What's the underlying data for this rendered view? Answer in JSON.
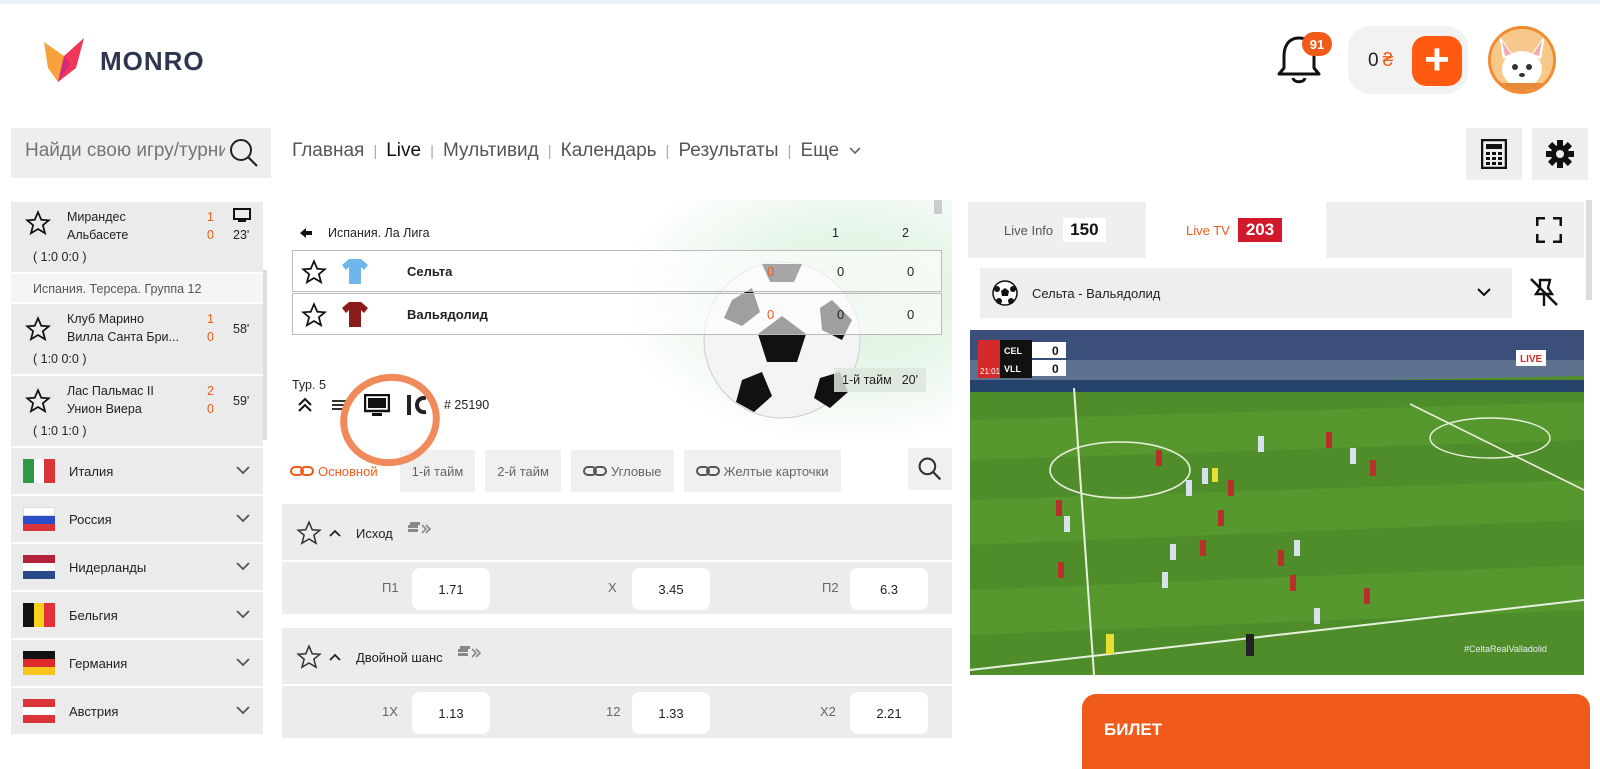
{
  "header": {
    "logo_text": "MONRO",
    "notif_count": "91",
    "balance_amount": "0",
    "balance_currency": "₴",
    "plus_label": "+"
  },
  "search": {
    "placeholder": "Найди свою игру/турнир"
  },
  "nav": {
    "items": [
      "Главная",
      "Live",
      "Мультивид",
      "Календарь",
      "Результаты",
      "Еще"
    ]
  },
  "sidebar": {
    "matches": [
      {
        "team1": "Мирандес",
        "team2": "Альбасете",
        "score1": "1",
        "score2": "0",
        "minute": "23'",
        "periods": "( 1:0   0:0 )"
      },
      {
        "team1": "Клуб Марино",
        "team2": "Вилла Санта Бри...",
        "score1": "1",
        "score2": "0",
        "minute": "58'",
        "periods": "( 1:0   0:0 )"
      },
      {
        "team1": "Лас Пальмас II",
        "team2": "Унион Виера",
        "score1": "2",
        "score2": "0",
        "minute": "59'",
        "periods": "( 1:0   1:0 )"
      }
    ],
    "league_header": "Испания. Терсера. Группа 12",
    "countries": [
      "Италия",
      "Россия",
      "Нидерланды",
      "Бельгия",
      "Германия",
      "Австрия"
    ]
  },
  "event": {
    "league": "Испания. Ла Лига",
    "col1": "1",
    "col2": "2",
    "team1": {
      "name": "Сельта",
      "s0": "0",
      "s1": "0",
      "s2": "0"
    },
    "team2": {
      "name": "Вальядолид",
      "s0": "0",
      "s1": "0",
      "s2": "0"
    },
    "round": "Тур. 5",
    "period_label": "1-й тайм",
    "period_minute": "20'",
    "event_id": "# 25190"
  },
  "market_tabs": [
    "Основной",
    "1-й тайм",
    "2-й тайм",
    "Угловые",
    "Желтые карточки"
  ],
  "markets": [
    {
      "name": "Исход",
      "odds": [
        {
          "label": "П1",
          "value": "1.71"
        },
        {
          "label": "Х",
          "value": "3.45"
        },
        {
          "label": "П2",
          "value": "6.3"
        }
      ]
    },
    {
      "name": "Двойной шанс",
      "odds": [
        {
          "label": "1Х",
          "value": "1.13"
        },
        {
          "label": "12",
          "value": "1.33"
        },
        {
          "label": "Х2",
          "value": "2.21"
        }
      ]
    }
  ],
  "right": {
    "live_info_label": "Live Info",
    "live_info_count": "150",
    "live_tv_label": "Live TV",
    "live_tv_count": "203",
    "selected_match": "Сельта - Вальядолид",
    "video": {
      "team1_abbr": "CEL",
      "team2_abbr": "VLL",
      "score1": "0",
      "score2": "0",
      "clock": "21:01",
      "live_badge": "LIVE",
      "hashtag": "#CeltaRealValladolid"
    },
    "ticket_label": "БИЛЕТ"
  },
  "colors": {
    "accent": "#f05a1a",
    "live_tv_badge": "#d2182b"
  }
}
